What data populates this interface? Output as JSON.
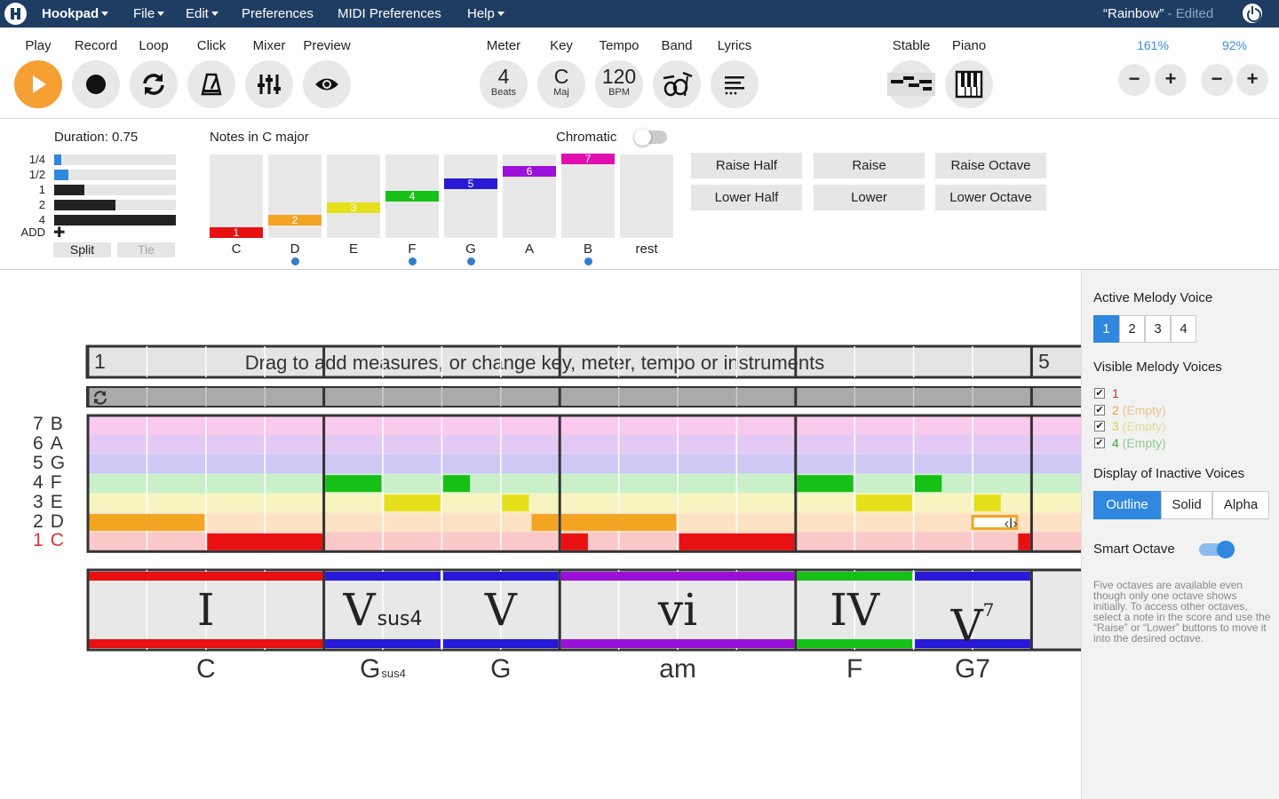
{
  "menubar": {
    "app": "Hookpad",
    "file": "File",
    "edit": "Edit",
    "preferences": "Preferences",
    "midi_preferences": "MIDI Preferences",
    "help": "Help",
    "song_title": "“Rainbow”",
    "edited": " - Edited"
  },
  "toolbar": {
    "play": "Play",
    "record": "Record",
    "loop": "Loop",
    "click": "Click",
    "mixer": "Mixer",
    "preview": "Preview",
    "meter": "Meter",
    "meter_value": "4",
    "meter_unit": "Beats",
    "key": "Key",
    "key_value": "C",
    "key_mode": "Maj",
    "tempo": "Tempo",
    "tempo_value": "120",
    "tempo_unit": "BPM",
    "band": "Band",
    "lyrics": "Lyrics",
    "stable": "Stable",
    "piano": "Piano",
    "zoom_h": "161%",
    "zoom_v": "92%",
    "minus": "−",
    "plus": "+"
  },
  "editor": {
    "duration": "Duration: 0.75",
    "durations": [
      {
        "label": "1/4",
        "fill": 0.06,
        "color": "#2f87e0"
      },
      {
        "label": "1/2",
        "fill": 0.12,
        "color": "#2f87e0"
      },
      {
        "label": "1",
        "fill": 0.25,
        "color": "#222222"
      },
      {
        "label": "2",
        "fill": 0.5,
        "color": "#222222"
      },
      {
        "label": "4",
        "fill": 1.0,
        "color": "#222222"
      }
    ],
    "add": "ADD",
    "split": "Split",
    "tie": "Tie",
    "notes_title": "Notes in C major",
    "chromatic": "Chromatic",
    "notes": [
      {
        "degree": "1",
        "name": "C",
        "color": "#e81010",
        "level": 1,
        "dot": false
      },
      {
        "degree": "2",
        "name": "D",
        "color": "#f3a423",
        "level": 2,
        "dot": true
      },
      {
        "degree": "3",
        "name": "E",
        "color": "#e6e01c",
        "level": 3,
        "dot": false
      },
      {
        "degree": "4",
        "name": "F",
        "color": "#16c016",
        "level": 4,
        "dot": true
      },
      {
        "degree": "5",
        "name": "G",
        "color": "#2818d8",
        "level": 5,
        "dot": true
      },
      {
        "degree": "6",
        "name": "A",
        "color": "#9a10d8",
        "level": 6,
        "dot": false
      },
      {
        "degree": "7",
        "name": "B",
        "color": "#e010b0",
        "level": 7,
        "dot": true
      },
      {
        "degree": "",
        "name": "rest",
        "color": "",
        "level": 0,
        "dot": false
      }
    ],
    "raise_half": "Raise Half",
    "raise": "Raise",
    "raise_octave": "Raise Octave",
    "lower_half": "Lower Half",
    "lower": "Lower",
    "lower_octave": "Lower Octave"
  },
  "score": {
    "measure_start": "1",
    "measure_next": "5",
    "hint": "Drag to add measures, or change key, meter, tempo or instruments",
    "rows": [
      {
        "deg": "7",
        "note": "B",
        "bg": "#f9c9ee",
        "red": false
      },
      {
        "deg": "6",
        "note": "A",
        "bg": "#e4c9f5",
        "red": false
      },
      {
        "deg": "5",
        "note": "G",
        "bg": "#cfc8f5",
        "red": false
      },
      {
        "deg": "4",
        "note": "F",
        "bg": "#c9f0c9",
        "red": false
      },
      {
        "deg": "3",
        "note": "E",
        "bg": "#f7f4c2",
        "red": false
      },
      {
        "deg": "2",
        "note": "D",
        "bg": "#fde3c4",
        "red": false
      },
      {
        "deg": "1",
        "note": "C",
        "bg": "#fbc9c9",
        "red": true
      }
    ],
    "notes": [
      {
        "row": 5,
        "start": 0,
        "len": 2,
        "color": "#f3a423"
      },
      {
        "row": 6,
        "start": 2,
        "len": 2,
        "color": "#e81010"
      },
      {
        "row": 3,
        "start": 4,
        "len": 1,
        "color": "#16c016"
      },
      {
        "row": 4,
        "start": 5,
        "len": 1,
        "color": "#e6e01c"
      },
      {
        "row": 3,
        "start": 6,
        "len": 0.5,
        "color": "#16c016"
      },
      {
        "row": 4,
        "start": 7,
        "len": 0.5,
        "color": "#e6e01c"
      },
      {
        "row": 5,
        "start": 7.5,
        "len": 0.5,
        "color": "#f3a423"
      },
      {
        "row": 6,
        "start": 8,
        "len": 0.5,
        "color": "#e81010"
      },
      {
        "row": 5,
        "start": 8,
        "len": 2,
        "color": "#f3a423"
      },
      {
        "row": 6,
        "start": 10,
        "len": 2,
        "color": "#e81010"
      },
      {
        "row": 3,
        "start": 12,
        "len": 1,
        "color": "#16c016"
      },
      {
        "row": 4,
        "start": 13,
        "len": 1,
        "color": "#e6e01c"
      },
      {
        "row": 3,
        "start": 14,
        "len": 0.5,
        "color": "#16c016"
      },
      {
        "row": 4,
        "start": 15,
        "len": 0.5,
        "color": "#e6e01c"
      },
      {
        "row": 6,
        "start": 15.75,
        "len": 0.25,
        "color": "#e81010"
      }
    ],
    "chords": [
      {
        "roman": "I",
        "sup": "",
        "sub": "",
        "name": "C",
        "name_sub": "",
        "start": 0,
        "len": 4,
        "color": "#e81010"
      },
      {
        "roman": "V",
        "sup": "",
        "sub": "sus4",
        "name": "G",
        "name_sub": "sus4",
        "start": 4,
        "len": 2,
        "color": "#2818d8"
      },
      {
        "roman": "V",
        "sup": "",
        "sub": "",
        "name": "G",
        "name_sub": "",
        "start": 6,
        "len": 2,
        "color": "#2818d8"
      },
      {
        "roman": "vi",
        "sup": "",
        "sub": "",
        "name": "am",
        "name_sub": "",
        "start": 8,
        "len": 4,
        "color": "#9a10d8"
      },
      {
        "roman": "IV",
        "sup": "",
        "sub": "",
        "name": "F",
        "name_sub": "",
        "start": 12,
        "len": 2,
        "color": "#16c016"
      },
      {
        "roman": "V",
        "sup": "7",
        "sub": "",
        "name": "G7",
        "name_sub": "",
        "start": 14,
        "len": 2,
        "color": "#2818d8"
      }
    ]
  },
  "sidebar": {
    "active_voice": "Active Melody Voice",
    "voices": [
      "1",
      "2",
      "3",
      "4"
    ],
    "active_index": 0,
    "visible_voices": "Visible Melody Voices",
    "voice_list": [
      {
        "num": "1",
        "text": "",
        "color": "#c0392b",
        "checked": "✔"
      },
      {
        "num": "2",
        "text": " (Empty)",
        "color": "#e0a23a",
        "checked": "✔"
      },
      {
        "num": "3",
        "text": " (Empty)",
        "color": "#d6cf4a",
        "checked": "✔"
      },
      {
        "num": "4",
        "text": " (Empty)",
        "color": "#3bab3b",
        "checked": "✔"
      }
    ],
    "display_inactive": "Display of Inactive Voices",
    "display_opts": [
      "Outline",
      "Solid",
      "Alpha"
    ],
    "display_active_index": 0,
    "smart_octave": "Smart Octave",
    "smart_octave_on": true,
    "help": "Five octaves are available even though only one octave shows initially. To access other octaves, select a note in the score and use the “Raise” or “Lower” buttons to move it into the desired octave."
  }
}
